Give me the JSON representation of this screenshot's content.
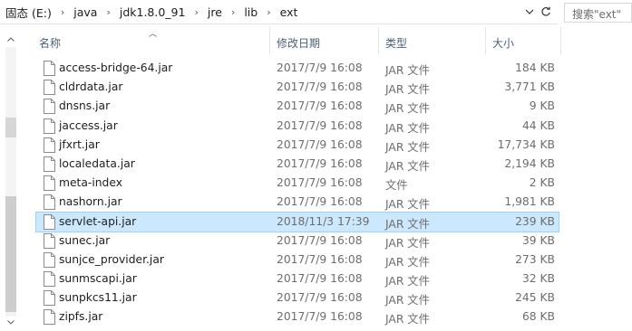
{
  "address": {
    "crumbs": [
      "固态 (E:)",
      "java",
      "jdk1.8.0_91",
      "jre",
      "lib",
      "ext"
    ],
    "search_placeholder": "搜索\"ext\""
  },
  "columns": {
    "name": "名称",
    "date": "修改日期",
    "type": "类型",
    "size": "大小"
  },
  "files": [
    {
      "name": "access-bridge-64.jar",
      "date": "2017/7/9 16:08",
      "type": "JAR 文件",
      "size": "184 KB",
      "selected": false
    },
    {
      "name": "cldrdata.jar",
      "date": "2017/7/9 16:08",
      "type": "JAR 文件",
      "size": "3,771 KB",
      "selected": false
    },
    {
      "name": "dnsns.jar",
      "date": "2017/7/9 16:08",
      "type": "JAR 文件",
      "size": "9 KB",
      "selected": false
    },
    {
      "name": "jaccess.jar",
      "date": "2017/7/9 16:08",
      "type": "JAR 文件",
      "size": "44 KB",
      "selected": false
    },
    {
      "name": "jfxrt.jar",
      "date": "2017/7/9 16:08",
      "type": "JAR 文件",
      "size": "17,734 KB",
      "selected": false
    },
    {
      "name": "localedata.jar",
      "date": "2017/7/9 16:08",
      "type": "JAR 文件",
      "size": "2,194 KB",
      "selected": false
    },
    {
      "name": "meta-index",
      "date": "2017/7/9 16:08",
      "type": "文件",
      "size": "2 KB",
      "selected": false
    },
    {
      "name": "nashorn.jar",
      "date": "2017/7/9 16:08",
      "type": "JAR 文件",
      "size": "1,981 KB",
      "selected": false
    },
    {
      "name": "servlet-api.jar",
      "date": "2018/11/3 17:39",
      "type": "JAR 文件",
      "size": "239 KB",
      "selected": true
    },
    {
      "name": "sunec.jar",
      "date": "2017/7/9 16:08",
      "type": "JAR 文件",
      "size": "39 KB",
      "selected": false
    },
    {
      "name": "sunjce_provider.jar",
      "date": "2017/7/9 16:08",
      "type": "JAR 文件",
      "size": "273 KB",
      "selected": false
    },
    {
      "name": "sunmscapi.jar",
      "date": "2017/7/9 16:08",
      "type": "JAR 文件",
      "size": "32 KB",
      "selected": false
    },
    {
      "name": "sunpkcs11.jar",
      "date": "2017/7/9 16:08",
      "type": "JAR 文件",
      "size": "245 KB",
      "selected": false
    },
    {
      "name": "zipfs.jar",
      "date": "2017/7/9 16:08",
      "type": "JAR 文件",
      "size": "68 KB",
      "selected": false
    }
  ],
  "icons": {
    "address_dropdown": "chevron-down-icon",
    "refresh": "refresh-icon",
    "file": "file-icon",
    "sort": "sort-up-icon"
  },
  "colors": {
    "selection_bg": "#cce8ff",
    "selection_border": "#99d1ff",
    "header_text": "#4c607a"
  }
}
